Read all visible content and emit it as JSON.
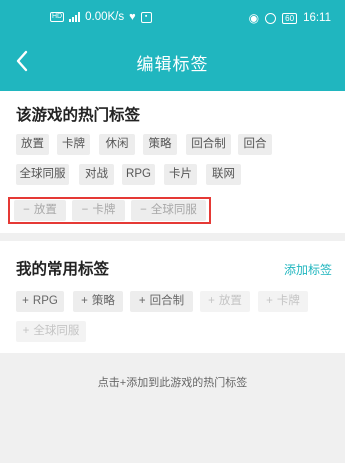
{
  "status": {
    "network_speed": "0.00K/s",
    "hd_label": "HD",
    "battery": "60",
    "time": "16:11"
  },
  "header": {
    "title": "编辑标签",
    "back_icon": "chevron-left-icon"
  },
  "hot_tags": {
    "title": "该游戏的热门标签",
    "rows": [
      [
        "放置",
        "卡牌",
        "休闲",
        "策略",
        "回合制",
        "回合"
      ],
      [
        "全球同服",
        "对战",
        "RPG",
        "卡片",
        "联网"
      ]
    ]
  },
  "selected_tags": {
    "items": [
      {
        "symbol": "−",
        "label": "放置"
      },
      {
        "symbol": "−",
        "label": "卡牌"
      },
      {
        "symbol": "−",
        "label": "全球同服"
      }
    ]
  },
  "common_tags": {
    "title": "我的常用标签",
    "add_label": "添加标签",
    "items": [
      {
        "symbol": "+",
        "label": "RPG"
      },
      {
        "symbol": "+",
        "label": "策略"
      },
      {
        "symbol": "+",
        "label": "回合制"
      },
      {
        "symbol": "+",
        "label": "放置"
      },
      {
        "symbol": "+",
        "label": "卡牌"
      },
      {
        "symbol": "+",
        "label": "全球同服"
      }
    ]
  },
  "hint": "点击+添加到此游戏的热门标签",
  "colors": {
    "accent": "#20b6bf",
    "highlight_border": "#e53935",
    "tag_bg": "#ededed"
  }
}
